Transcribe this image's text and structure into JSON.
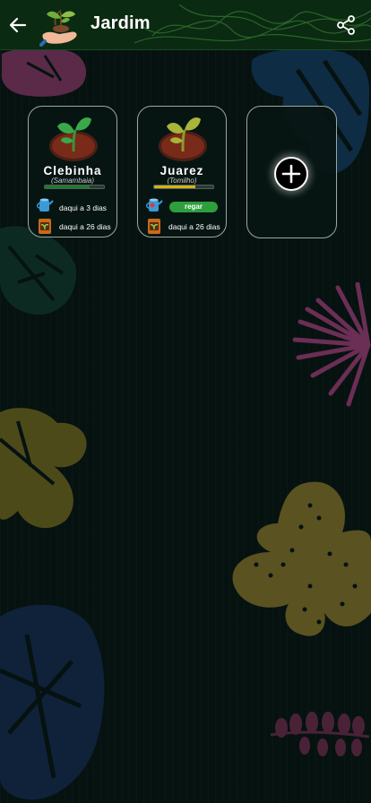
{
  "header": {
    "title": "Jardim",
    "back_icon": "arrow-left-icon",
    "logo_icon": "hand-seedling-icon",
    "share_icon": "share-icon"
  },
  "plants": [
    {
      "name": "Clebinha",
      "species": "(Samambaia)",
      "water_level": 0.75,
      "bar_color": "#1f7a2e",
      "water_text": "daqui a 3 dias",
      "fertilize_text": "daqui a 26 dias"
    },
    {
      "name": "Juarez",
      "species": "(Tomilho)",
      "water_level": 0.7,
      "bar_color": "#d4b316",
      "water_action": "regar",
      "fertilize_text": "daqui a 26 dias"
    }
  ],
  "add_card": {
    "icon": "plus-icon"
  },
  "colors": {
    "background": "#061210",
    "appbar": "#0b2a12",
    "action_green": "#2f9e3c"
  }
}
